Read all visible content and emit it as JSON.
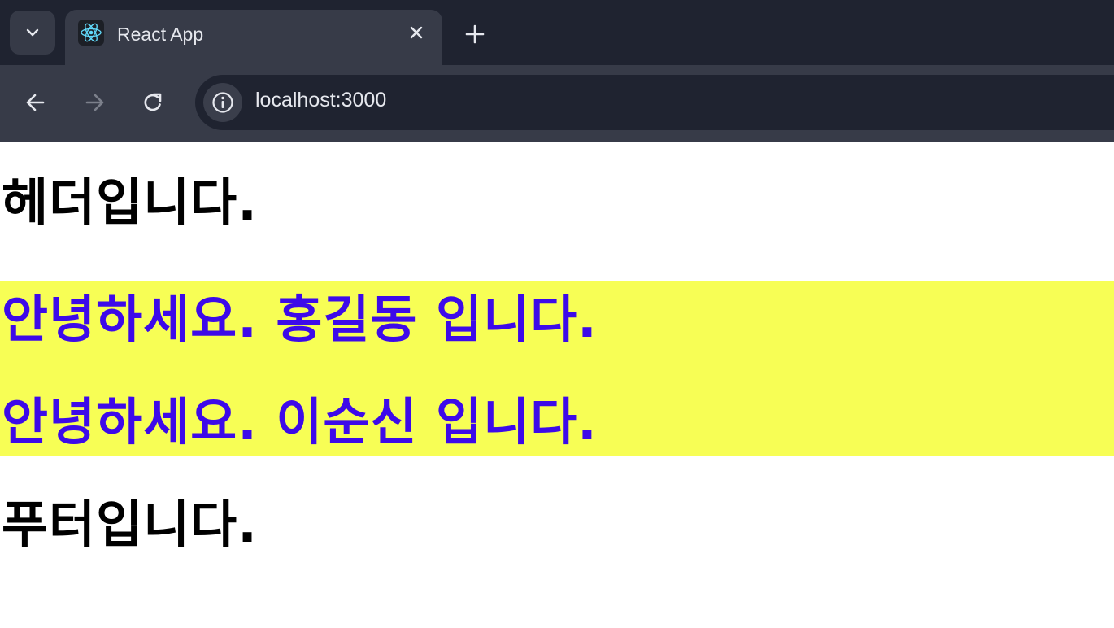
{
  "browser": {
    "tab": {
      "title": "React App",
      "favicon": "react-logo-icon"
    },
    "address_bar": {
      "url": "localhost:3000"
    },
    "colors": {
      "tabstrip": "#1f2330",
      "toolbar": "#373b48",
      "omnibox": "#1f2330"
    }
  },
  "page": {
    "header": "헤더입니다.",
    "greetings": [
      "안녕하세요. 홍길동 입니다.",
      "안녕하세요. 이순신 입니다."
    ],
    "footer": "푸터입니다.",
    "colors": {
      "greeting_background": "#f7fe55",
      "greeting_text": "#3d0ae9"
    }
  }
}
